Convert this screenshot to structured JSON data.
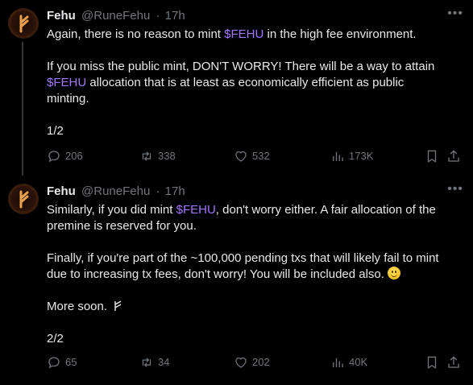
{
  "tweets": [
    {
      "name": "Fehu",
      "handle": "@RuneFehu",
      "sep": "·",
      "time": "17h",
      "p1_pre": "Again, there is no reason to mint ",
      "p1_cash": "$FEHU",
      "p1_post": " in the high fee environment.",
      "p2_a": "If you miss the public mint, DON'T WORRY! There will be a way to attain",
      "p2_cash": "$FEHU",
      "p2_b": " allocation that is at least as economically efficient as public",
      "p2_c": "minting.",
      "p3": "1/2",
      "stats": {
        "replies": "206",
        "reposts": "338",
        "likes": "532",
        "views": "173K"
      }
    },
    {
      "name": "Fehu",
      "handle": "@RuneFehu",
      "sep": "·",
      "time": "17h",
      "p1_pre": "Similarly, if you did mint ",
      "p1_cash": "$FEHU",
      "p1_post": ", don't worry either. A fair allocation of the",
      "p1_line2": "premine is reserved for you.",
      "p2_a": "Finally, if you're part of the ~100,000 pending txs that will likely fail to mint",
      "p2_b": "due to increasing tx fees, don't worry! You will be included also. ",
      "p3": "More soon. ",
      "p4": "2/2",
      "stats": {
        "replies": "65",
        "reposts": "34",
        "likes": "202",
        "views": "40K"
      }
    }
  ],
  "icons": {
    "reply": "reply-icon",
    "repost": "repost-icon",
    "like": "heart-icon",
    "views": "views-icon",
    "bookmark": "bookmark-icon",
    "share": "share-icon",
    "more": "more-icon"
  },
  "colors": {
    "background": "#000000",
    "text": "#e7e9ea",
    "muted": "#71767b",
    "cashtag": "#a277ff"
  }
}
